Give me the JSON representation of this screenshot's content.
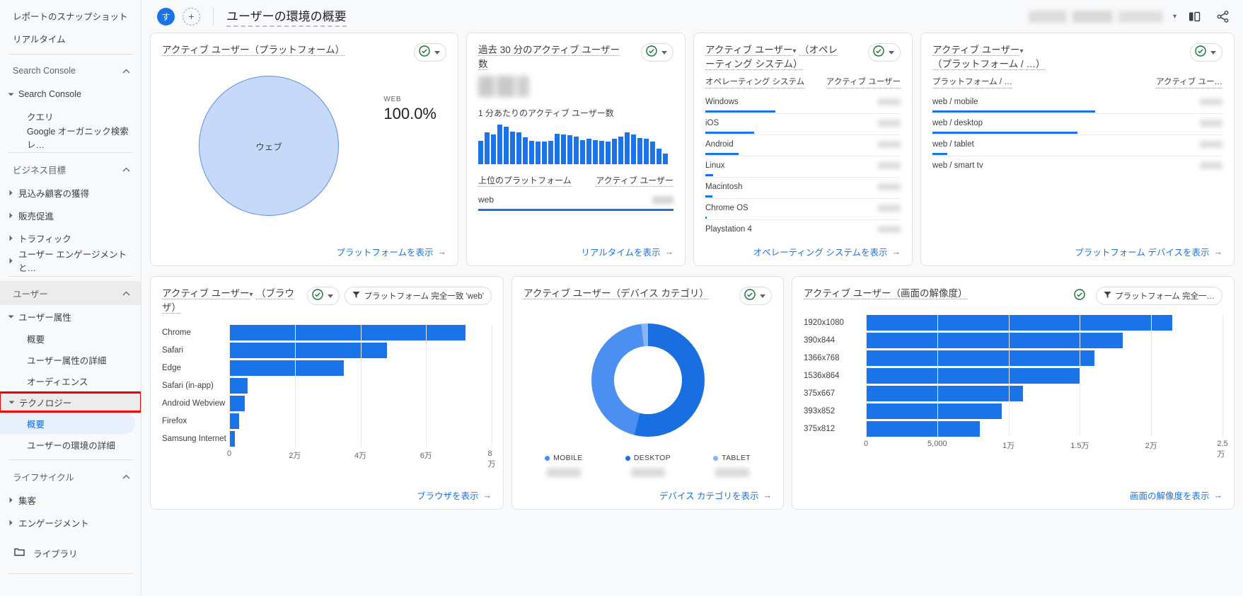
{
  "sidebar": {
    "top_items": [
      {
        "label": "レポートのスナップショット"
      },
      {
        "label": "リアルタイム"
      }
    ],
    "sections": [
      {
        "title": "Search Console",
        "groups": [
          {
            "label": "Search Console",
            "expanded": true,
            "children": [
              {
                "label": "クエリ"
              },
              {
                "label": "Google オーガニック検索レ…"
              }
            ]
          }
        ]
      },
      {
        "title": "ビジネス目標",
        "groups": [
          {
            "label": "見込み顧客の獲得",
            "expanded": false,
            "children": []
          },
          {
            "label": "販売促進",
            "expanded": false,
            "children": []
          },
          {
            "label": "トラフィック",
            "expanded": false,
            "children": []
          },
          {
            "label": "ユーザー エンゲージメントと…",
            "expanded": false,
            "children": []
          }
        ]
      },
      {
        "title": "ユーザー",
        "groups": [
          {
            "label": "ユーザー属性",
            "expanded": true,
            "children": [
              {
                "label": "概要"
              },
              {
                "label": "ユーザー属性の詳細"
              },
              {
                "label": "オーディエンス"
              }
            ]
          },
          {
            "label": "テクノロジー",
            "expanded": true,
            "highlighted": true,
            "children": [
              {
                "label": "概要",
                "selected": true
              },
              {
                "label": "ユーザーの環境の詳細"
              }
            ]
          }
        ]
      },
      {
        "title": "ライフサイクル",
        "groups": [
          {
            "label": "集客",
            "expanded": false,
            "children": []
          },
          {
            "label": "エンゲージメント",
            "expanded": false,
            "children": []
          }
        ]
      }
    ],
    "library_label": "ライブラリ"
  },
  "topbar": {
    "avatar_text": "す",
    "add_label": "+",
    "page_title": "ユーザーの環境の概要",
    "date_range_value": "",
    "compare_icon": "compare-icon",
    "share_icon": "share-icon"
  },
  "cards": {
    "platform_pie": {
      "title": "アクティブ ユーザー（プラットフォーム）",
      "slice_label": "ウェブ",
      "stat_key": "WEB",
      "stat_value": "100.0%",
      "footer_link": "プラットフォームを表示"
    },
    "realtime": {
      "title": "過去 30 分のアクティブ ユーザー数",
      "big_number": "",
      "sub_title": "1 分あたりのアクティブ ユーザー数",
      "table_head_left": "上位のプラットフォーム",
      "table_head_right": "アクティブ ユーザー",
      "rows": [
        {
          "name": "web",
          "value": ""
        }
      ],
      "footer_link": "リアルタイムを表示"
    },
    "os_list": {
      "metric_label": "アクティブ ユーザー",
      "title_suffix": "（オペレーティング システム）",
      "col_dim": "オペレーティング システム",
      "col_metric": "アクティブ ユーザー",
      "rows": [
        {
          "name": "Windows",
          "pct": 36
        },
        {
          "name": "iOS",
          "pct": 25
        },
        {
          "name": "Android",
          "pct": 17
        },
        {
          "name": "Linux",
          "pct": 4
        },
        {
          "name": "Macintosh",
          "pct": 3.5
        },
        {
          "name": "Chrome OS",
          "pct": 0.8
        },
        {
          "name": "Playstation 4",
          "pct": 0
        }
      ],
      "footer_link": "オペレーティング システムを表示"
    },
    "platform_device_list": {
      "metric_label": "アクティブ ユーザー",
      "title_suffix": "（プラットフォーム / …）",
      "col_dim": "プラットフォーム / …",
      "col_metric": "アクティブ ユー…",
      "rows": [
        {
          "name": "web / mobile",
          "pct": 56
        },
        {
          "name": "web / desktop",
          "pct": 50
        },
        {
          "name": "web / tablet",
          "pct": 5
        },
        {
          "name": "web / smart tv",
          "pct": 0
        }
      ],
      "footer_link": "プラットフォーム デバイスを表示"
    },
    "browser_chart": {
      "metric_label": "アクティブ ユーザー",
      "title_suffix": "（ブラウザ）",
      "filter_chip": "プラットフォーム 完全一致 'web'",
      "footer_link": "ブラウザを表示"
    },
    "device_donut": {
      "title": "アクティブ ユーザー（デバイス カテゴリ）",
      "legend": [
        {
          "label": "MOBILE",
          "value": "",
          "color": "#4b90f0"
        },
        {
          "label": "DESKTOP",
          "value": "",
          "color": "#1a6fe0"
        },
        {
          "label": "TABLET",
          "value": "",
          "color": "#8ab4f8"
        }
      ],
      "footer_link": "デバイス カテゴリを表示"
    },
    "resolution_chart": {
      "title": "アクティブ ユーザー（画面の解像度）",
      "filter_chip": "プラットフォーム 完全一…",
      "footer_link": "画面の解像度を表示"
    }
  },
  "chart_data": [
    {
      "type": "pie",
      "title": "アクティブ ユーザー（プラットフォーム）",
      "categories": [
        "ウェブ"
      ],
      "values": [
        100.0
      ],
      "unit": "%",
      "legend": [
        "WEB"
      ]
    },
    {
      "type": "bar",
      "title": "1 分あたりのアクティブ ユーザー数",
      "categories": [
        "1",
        "2",
        "3",
        "4",
        "5",
        "6",
        "7",
        "8",
        "9",
        "10",
        "11",
        "12",
        "13",
        "14",
        "15",
        "16",
        "17",
        "18",
        "19",
        "20",
        "21",
        "22",
        "23",
        "24",
        "25",
        "26",
        "27",
        "28",
        "29",
        "30"
      ],
      "values": [
        52,
        70,
        66,
        88,
        84,
        72,
        70,
        60,
        52,
        50,
        50,
        52,
        68,
        66,
        64,
        62,
        54,
        56,
        54,
        52,
        50,
        56,
        62,
        70,
        66,
        58,
        56,
        50,
        34,
        24
      ],
      "ylabel": "アクティブ ユーザー",
      "grid": false
    },
    {
      "type": "bar",
      "orientation": "horizontal",
      "title": "アクティブ ユーザー（オペレーティング システム）",
      "categories": [
        "Windows",
        "iOS",
        "Android",
        "Linux",
        "Macintosh",
        "Chrome OS",
        "Playstation 4"
      ],
      "values": [
        36,
        25,
        17,
        4,
        3.5,
        0.8,
        0
      ],
      "unit": "relative-%"
    },
    {
      "type": "bar",
      "orientation": "horizontal",
      "title": "アクティブ ユーザー（プラットフォーム / デバイス カテゴリ）",
      "categories": [
        "web / mobile",
        "web / desktop",
        "web / tablet",
        "web / smart tv"
      ],
      "values": [
        56,
        50,
        5,
        0
      ],
      "unit": "relative-%"
    },
    {
      "type": "bar",
      "orientation": "horizontal",
      "title": "アクティブ ユーザー（ブラウザ）",
      "categories": [
        "Chrome",
        "Safari",
        "Edge",
        "Safari (in-app)",
        "Android Webview",
        "Firefox",
        "Samsung Internet"
      ],
      "values": [
        72000,
        48000,
        35000,
        5600,
        4800,
        3000,
        1700
      ],
      "xlabel": "",
      "ylabel": "",
      "xticks": [
        "0",
        "2万",
        "4万",
        "6万",
        "8万"
      ],
      "xtickvalues": [
        0,
        20000,
        40000,
        60000,
        80000
      ],
      "xlim": [
        0,
        80000
      ],
      "grid": true
    },
    {
      "type": "pie",
      "subtype": "donut",
      "title": "アクティブ ユーザー（デバイス カテゴリ）",
      "categories": [
        "DESKTOP",
        "MOBILE",
        "TABLET"
      ],
      "values": [
        53.9,
        44.2,
        1.9
      ],
      "unit": "%",
      "legend_position": "bottom"
    },
    {
      "type": "bar",
      "orientation": "horizontal",
      "title": "アクティブ ユーザー（画面の解像度）",
      "categories": [
        "1920x1080",
        "390x844",
        "1366x768",
        "1536x864",
        "375x667",
        "393x852",
        "375x812"
      ],
      "values": [
        21500,
        18000,
        16000,
        15000,
        11000,
        9500,
        8000
      ],
      "xticks": [
        "0",
        "5,000",
        "1万",
        "1.5万",
        "2万",
        "2.5万"
      ],
      "xtickvalues": [
        0,
        5000,
        10000,
        15000,
        20000,
        25000
      ],
      "xlim": [
        0,
        25000
      ],
      "grid": true
    }
  ]
}
